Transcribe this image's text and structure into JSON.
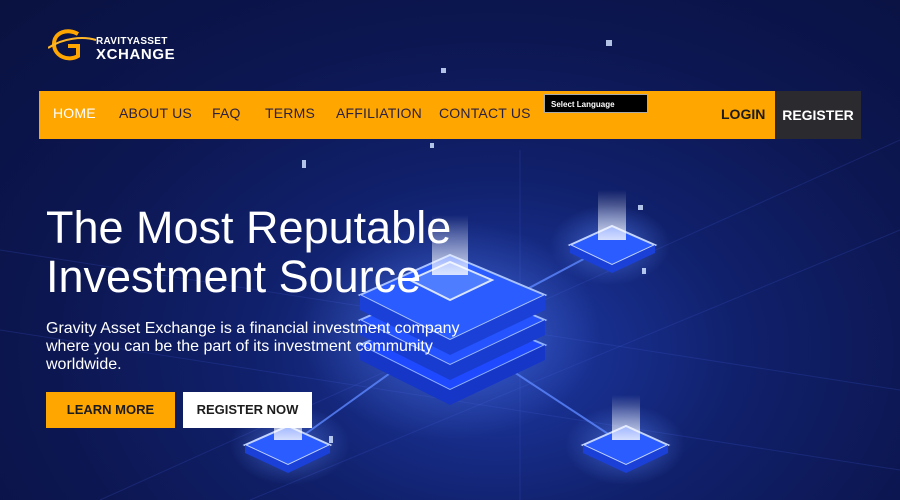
{
  "brand": {
    "line1": "RAVITYASSET",
    "line2": "XCHANGE",
    "mark": "G-E-swoosh-logo",
    "accent": "#ffa600"
  },
  "nav": {
    "items": [
      {
        "label": "HOME",
        "active": true
      },
      {
        "label": "ABOUT US"
      },
      {
        "label": "FAQ"
      },
      {
        "label": "TERMS"
      },
      {
        "label": "AFFILIATION"
      },
      {
        "label": "CONTACT US"
      }
    ],
    "language": "Select Language",
    "login": "LOGIN",
    "register": "REGISTER"
  },
  "hero": {
    "title_line1": "The Most Reputable",
    "title_line2": "Investment Source",
    "description": "Gravity Asset Exchange is a financial investment company where you can be the part of its investment community worldwide.",
    "learn_more": "LEARN MORE",
    "register_now": "REGISTER NOW"
  },
  "colors": {
    "background": "#0c1650",
    "nav_bg": "#ffa600",
    "register_bg": "#2b2b2f",
    "node_blue": "#2f5bff"
  }
}
